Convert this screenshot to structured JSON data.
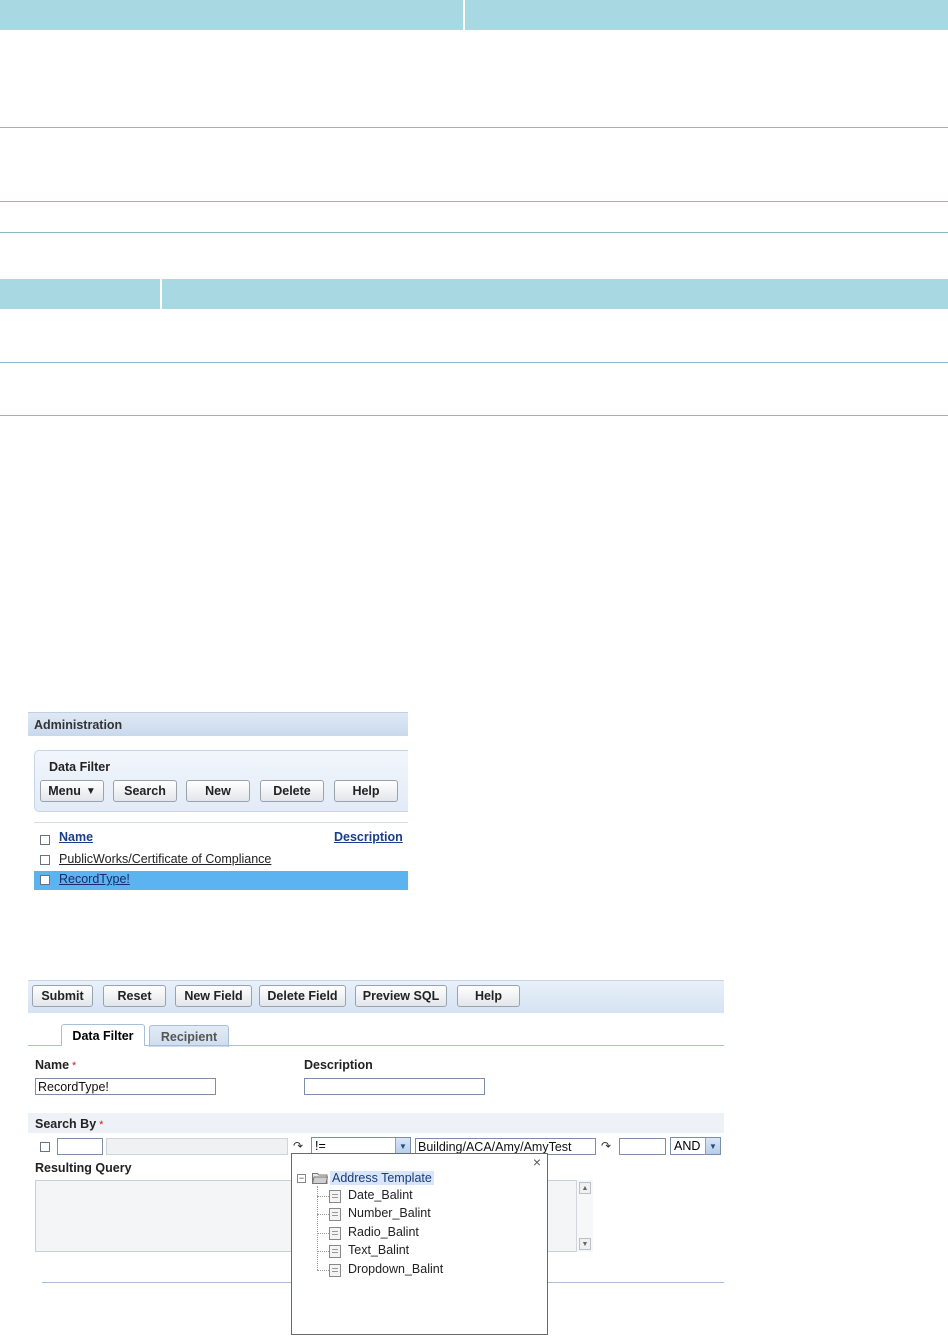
{
  "admin": {
    "header": "Administration",
    "panel_title": "Data Filter",
    "buttons": {
      "menu": "Menu",
      "search": "Search",
      "new": "New",
      "delete": "Delete",
      "help": "Help"
    },
    "columns": {
      "name": "Name",
      "description": "Description"
    },
    "rows": [
      {
        "name": "PublicWorks/Certificate of Compliance",
        "selected": false
      },
      {
        "name": "RecordType!",
        "selected": true
      }
    ]
  },
  "form": {
    "toolbar": {
      "submit": "Submit",
      "reset": "Reset",
      "new_field": "New Field",
      "delete_field": "Delete Field",
      "preview_sql": "Preview SQL",
      "help": "Help"
    },
    "tabs": {
      "data_filter": "Data Filter",
      "recipient": "Recipient"
    },
    "name_label": "Name",
    "name_value": "RecordType!",
    "description_label": "Description",
    "description_value": "",
    "required_mark": "*",
    "search_by_label": "Search By",
    "operator_value": "!=",
    "value_field": "Building/ACA/Amy/AmyTest",
    "logic_value": "AND",
    "resulting_query_label": "Resulting Query"
  },
  "popup": {
    "close": "×",
    "root": "Address Template",
    "items": [
      "Date_Balint",
      "Number_Balint",
      "Radio_Balint",
      "Text_Balint",
      "Dropdown_Balint"
    ]
  },
  "colors": {
    "header_teal": "#a8d8e2",
    "selected_row": "#5bb4f0",
    "link": "#1a3e8c"
  }
}
